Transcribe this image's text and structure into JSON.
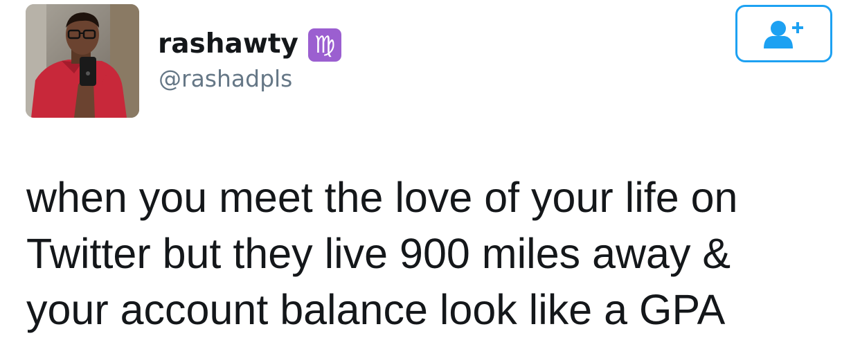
{
  "tweet": {
    "user": {
      "display_name": "rashawty",
      "name_badge_glyph": "♍",
      "handle": "@rashadpls",
      "avatar_icon": "profile-photo"
    },
    "follow_button": {
      "icon": "add-user-icon",
      "color": "#1da1f2"
    },
    "text_lines": [
      "when you meet the love of your life on",
      "Twitter but they live 900 miles away &",
      "your account balance look like a GPA"
    ]
  },
  "colors": {
    "text_primary": "#14171a",
    "text_secondary": "#657786",
    "accent": "#1da1f2",
    "badge_purple": "#9b5fd0"
  }
}
